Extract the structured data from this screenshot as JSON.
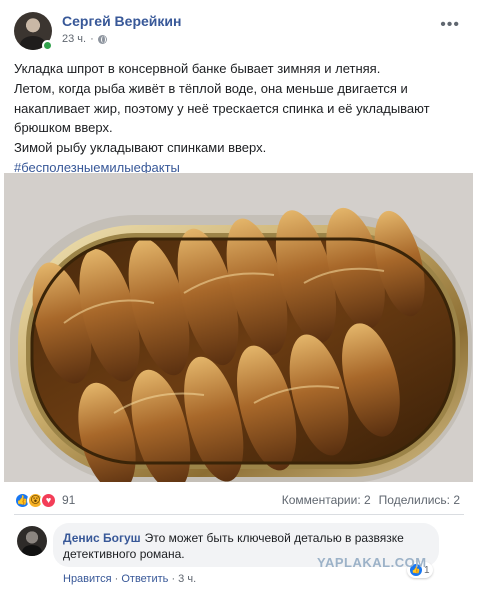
{
  "post": {
    "author": "Сергей Верейкин",
    "time": "23 ч.",
    "separator": "·",
    "more_icon": "ellipsis-icon",
    "privacy_icon": "globe-icon",
    "text_lines": [
      "Укладка шпрот в консервной банке бывает зимняя и летняя.",
      "Летом, когда рыба живёт в тёплой воде, она меньше двигается и",
      "накапливает жир, поэтому у неё трескается спинка и её укладывают",
      "брюшком вверх.",
      "Зимой рыбу укладывают спинками вверх."
    ],
    "hashtag": "#бесполезныемилыефакты",
    "photo_description": "open tin of sprats"
  },
  "reactions": {
    "icons": [
      "like-icon",
      "wow-icon",
      "love-icon"
    ],
    "count": "91",
    "comments": "Комментарии: 2",
    "shares": "Поделились: 2"
  },
  "comment": {
    "author": "Денис Богуш",
    "text": "Это может быть ключевой деталью в развязке детективного романа.",
    "like_count": "1",
    "actions": {
      "like": "Нравится",
      "dot": "·",
      "reply": "Ответить",
      "time": "3 ч."
    }
  },
  "watermark": "YAPLAKAL.COM",
  "colors": {
    "link_blue": "#385898",
    "like_blue": "#1877f2",
    "love_red": "#f33e58",
    "wow_yellow": "#f7b125",
    "online_green": "#31a24c"
  }
}
